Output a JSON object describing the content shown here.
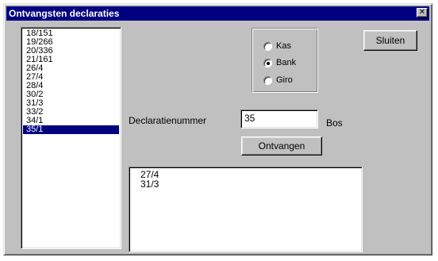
{
  "window": {
    "title": "Ontvangsten declaraties",
    "close_glyph": "✕"
  },
  "list": {
    "items": [
      "18/151",
      "19/266",
      "20/336",
      "21/161",
      "26/4",
      "27/4",
      "28/4",
      "30/2",
      "31/3",
      "33/2",
      "34/1",
      "35/1"
    ],
    "selected_index": 11
  },
  "payment": {
    "options": [
      {
        "label": "Kas",
        "checked": false
      },
      {
        "label": "Bank",
        "checked": true
      },
      {
        "label": "Giro",
        "checked": false
      }
    ]
  },
  "form": {
    "declaration_label": "Declaratienummer",
    "declaration_value": "35",
    "unit_label": "Bos"
  },
  "buttons": {
    "receive": "Ontvangen",
    "close": "Sluiten"
  },
  "received": {
    "lines": [
      "27/4",
      "31/3"
    ]
  }
}
